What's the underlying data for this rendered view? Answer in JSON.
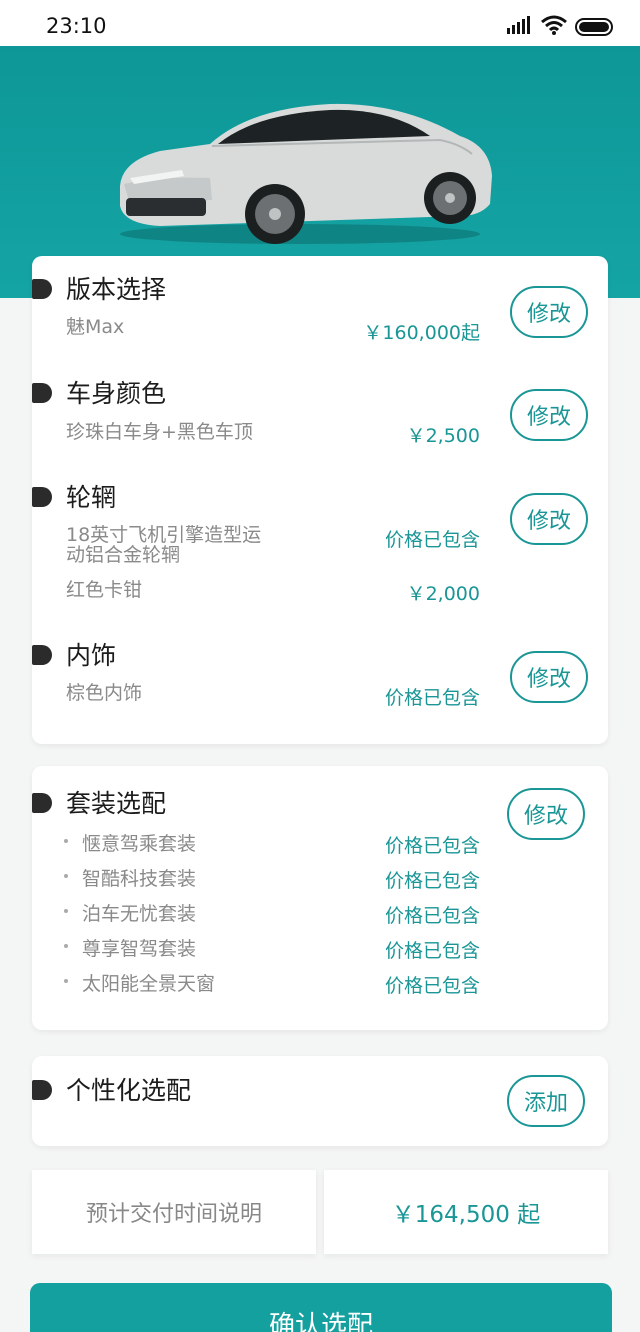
{
  "status_bar": {
    "time": "23:10"
  },
  "sections": {
    "version": {
      "title": "版本选择",
      "item": "魅Max",
      "price": "￥160,000起",
      "button": "修改"
    },
    "color": {
      "title": "车身颜色",
      "item": "珍珠白车身+黑色车顶",
      "price": "￥2,500",
      "button": "修改"
    },
    "wheels": {
      "title": "轮辋",
      "item1_line1": "18英寸飞机引擎造型运",
      "item1_line2": "动铝合金轮辋",
      "item1_price": "价格已包含",
      "item2": "红色卡钳",
      "item2_price": "￥2,000",
      "button": "修改"
    },
    "interior": {
      "title": "内饰",
      "item": "棕色内饰",
      "price": "价格已包含",
      "button": "修改"
    },
    "packages": {
      "title": "套装选配",
      "button": "修改",
      "items": [
        {
          "name": "惬意驾乘套装",
          "price": "价格已包含"
        },
        {
          "name": "智酷科技套装",
          "price": "价格已包含"
        },
        {
          "name": "泊车无忧套装",
          "price": "价格已包含"
        },
        {
          "name": "尊享智驾套装",
          "price": "价格已包含"
        },
        {
          "name": "太阳能全景天窗",
          "price": "价格已包含"
        }
      ]
    },
    "custom": {
      "title": "个性化选配",
      "button": "添加"
    }
  },
  "footer": {
    "delivery_label": "预计交付时间说明",
    "total_price": "￥164,500 起",
    "confirm_label": "确认选配"
  },
  "colors": {
    "accent": "#1a9696",
    "hero": "#129f9f"
  }
}
